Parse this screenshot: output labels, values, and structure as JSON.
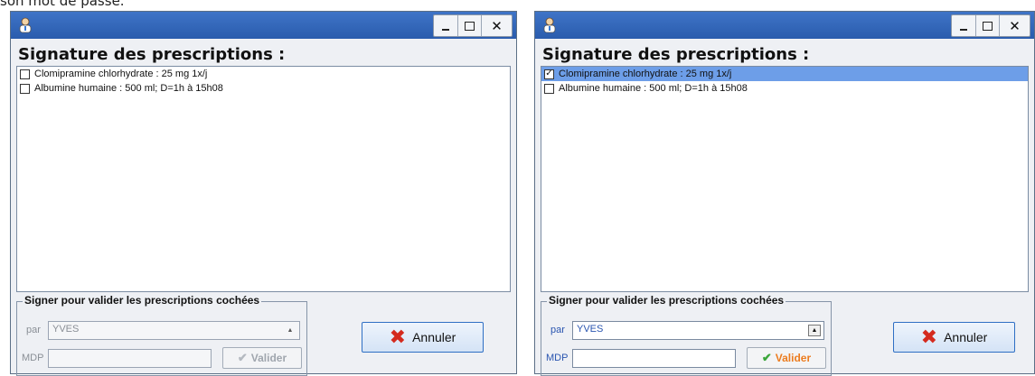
{
  "caption": "son mot de passe.",
  "windows": [
    {
      "heading": "Signature des prescriptions :",
      "controls": {
        "minimize": "_",
        "close": "✕"
      },
      "items": [
        {
          "checked": false,
          "mark": "",
          "label": "Clomipramine chlorhydrate : 25 mg 1x/j",
          "selected": false
        },
        {
          "checked": false,
          "mark": "",
          "label": "Albumine humaine : 500 ml; D=1h à 15h08",
          "selected": false
        }
      ],
      "group": {
        "title": "Signer pour valider les prescriptions cochées",
        "par_label": "par",
        "user_value": "YVES",
        "mdp_label": "MDP",
        "password_value": "",
        "valider_label": "Valider",
        "valider_enabled": false
      },
      "annuler_label": "Annuler"
    },
    {
      "heading": "Signature des prescriptions :",
      "controls": {
        "minimize": "_",
        "close": "✕"
      },
      "items": [
        {
          "checked": true,
          "mark": "✓",
          "label": "Clomipramine chlorhydrate : 25 mg 1x/j",
          "selected": true
        },
        {
          "checked": false,
          "mark": "",
          "label": "Albumine humaine : 500 ml; D=1h à 15h08",
          "selected": false
        }
      ],
      "group": {
        "title": "Signer pour valider les prescriptions cochées",
        "par_label": "par",
        "user_value": "YVES",
        "mdp_label": "MDP",
        "password_value": "",
        "valider_label": "Valider",
        "valider_enabled": true
      },
      "annuler_label": "Annuler"
    }
  ],
  "colors": {
    "titlebar": "#2a5cad",
    "selection": "#6d9ee8",
    "valider_active": "#ec7c1f",
    "check_green": "#3aa63a",
    "annuler_x": "#d42a1e"
  }
}
